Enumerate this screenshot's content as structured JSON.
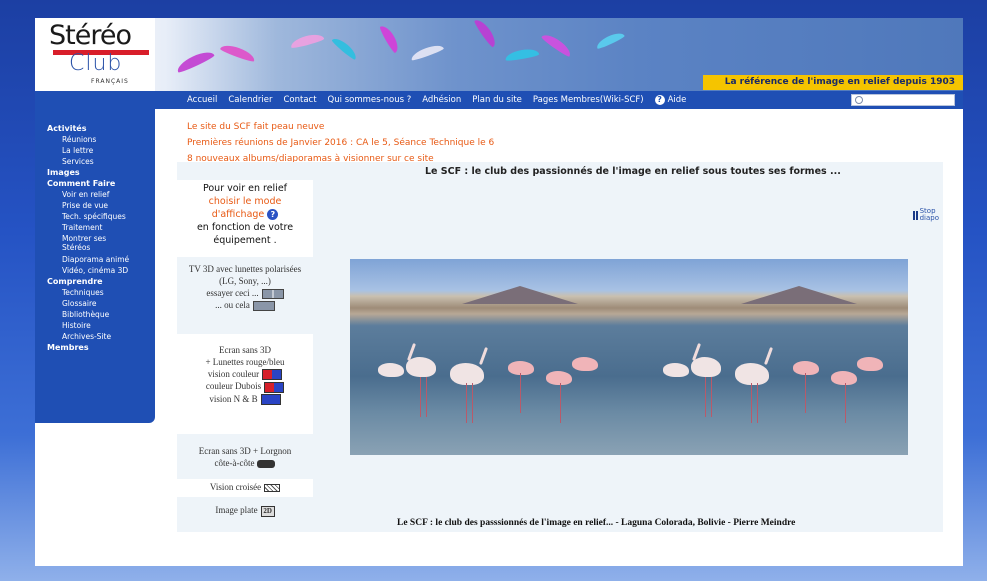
{
  "banner": {
    "logo_line1": "Stéréo",
    "logo_line2": "Club",
    "logo_line3": "FRANÇAIS",
    "slogan": "La référence de l'image en relief depuis 1903"
  },
  "nav": {
    "items": [
      "Accueil",
      "Calendrier",
      "Contact",
      "Qui sommes-nous ?",
      "Adhésion",
      "Plan du site",
      "Pages Membres(Wiki-SCF)"
    ],
    "help_label": "Aide",
    "search_placeholder": ""
  },
  "sidebar": {
    "activites": "Activités",
    "activites_items": [
      "Réunions",
      "La lettre",
      "Services"
    ],
    "images": "Images",
    "comment_faire": "Comment Faire",
    "comment_items": [
      "Voir en relief",
      "Prise de vue",
      "Tech. spécifiques",
      "Traitement",
      "Montrer ses",
      "Stéréos",
      "Diaporama animé",
      "Vidéo, cinéma 3D"
    ],
    "comprendre": "Comprendre",
    "comprendre_items": [
      "Techniques",
      "Glossaire",
      "Bibliothèque",
      "Histoire",
      "Archives-Site"
    ],
    "membres": "Membres"
  },
  "news": {
    "line1": "Le site du SCF fait peau neuve",
    "line2": "Premières réunions de Janvier 2016 : CA le 5, Séance Technique le 6",
    "line3": "8 nouveaux albums/diaporamas à visionner sur ce site"
  },
  "main": {
    "tagline": "Le SCF : le club des passionnés de l'image en relief sous toutes ses formes ...",
    "relief_l1": "Pour voir en relief",
    "relief_l2": "choisir le mode",
    "relief_l3": "d'affichage",
    "relief_l4": "en fonction de votre",
    "relief_l5": "équipement .",
    "tv_l1": "TV 3D avec lunettes polarisées",
    "tv_l2": "(LG, Sony, ...)",
    "tv_l3": "essayer ceci ...",
    "tv_l4": "... ou cela",
    "ecran_l1": "Ecran sans 3D",
    "ecran_l2": "+ Lunettes rouge/bleu",
    "ecran_l3": "vision couleur",
    "ecran_l4": "couleur Dubois",
    "ecran_l5": "vision N & B",
    "lorgnon_l1": "Ecran sans 3D  + Lorgnon",
    "lorgnon_l2": "côte-à-côte",
    "croisee": "Vision croisée",
    "plate": "Image plate",
    "plate_badge": "2D",
    "pause_l1": "Stop",
    "pause_l2": "diapo",
    "caption": "Le SCF : le club des passsionnés de l'image en relief... - Laguna Colorada, Bolivie - Pierre Meindre"
  }
}
